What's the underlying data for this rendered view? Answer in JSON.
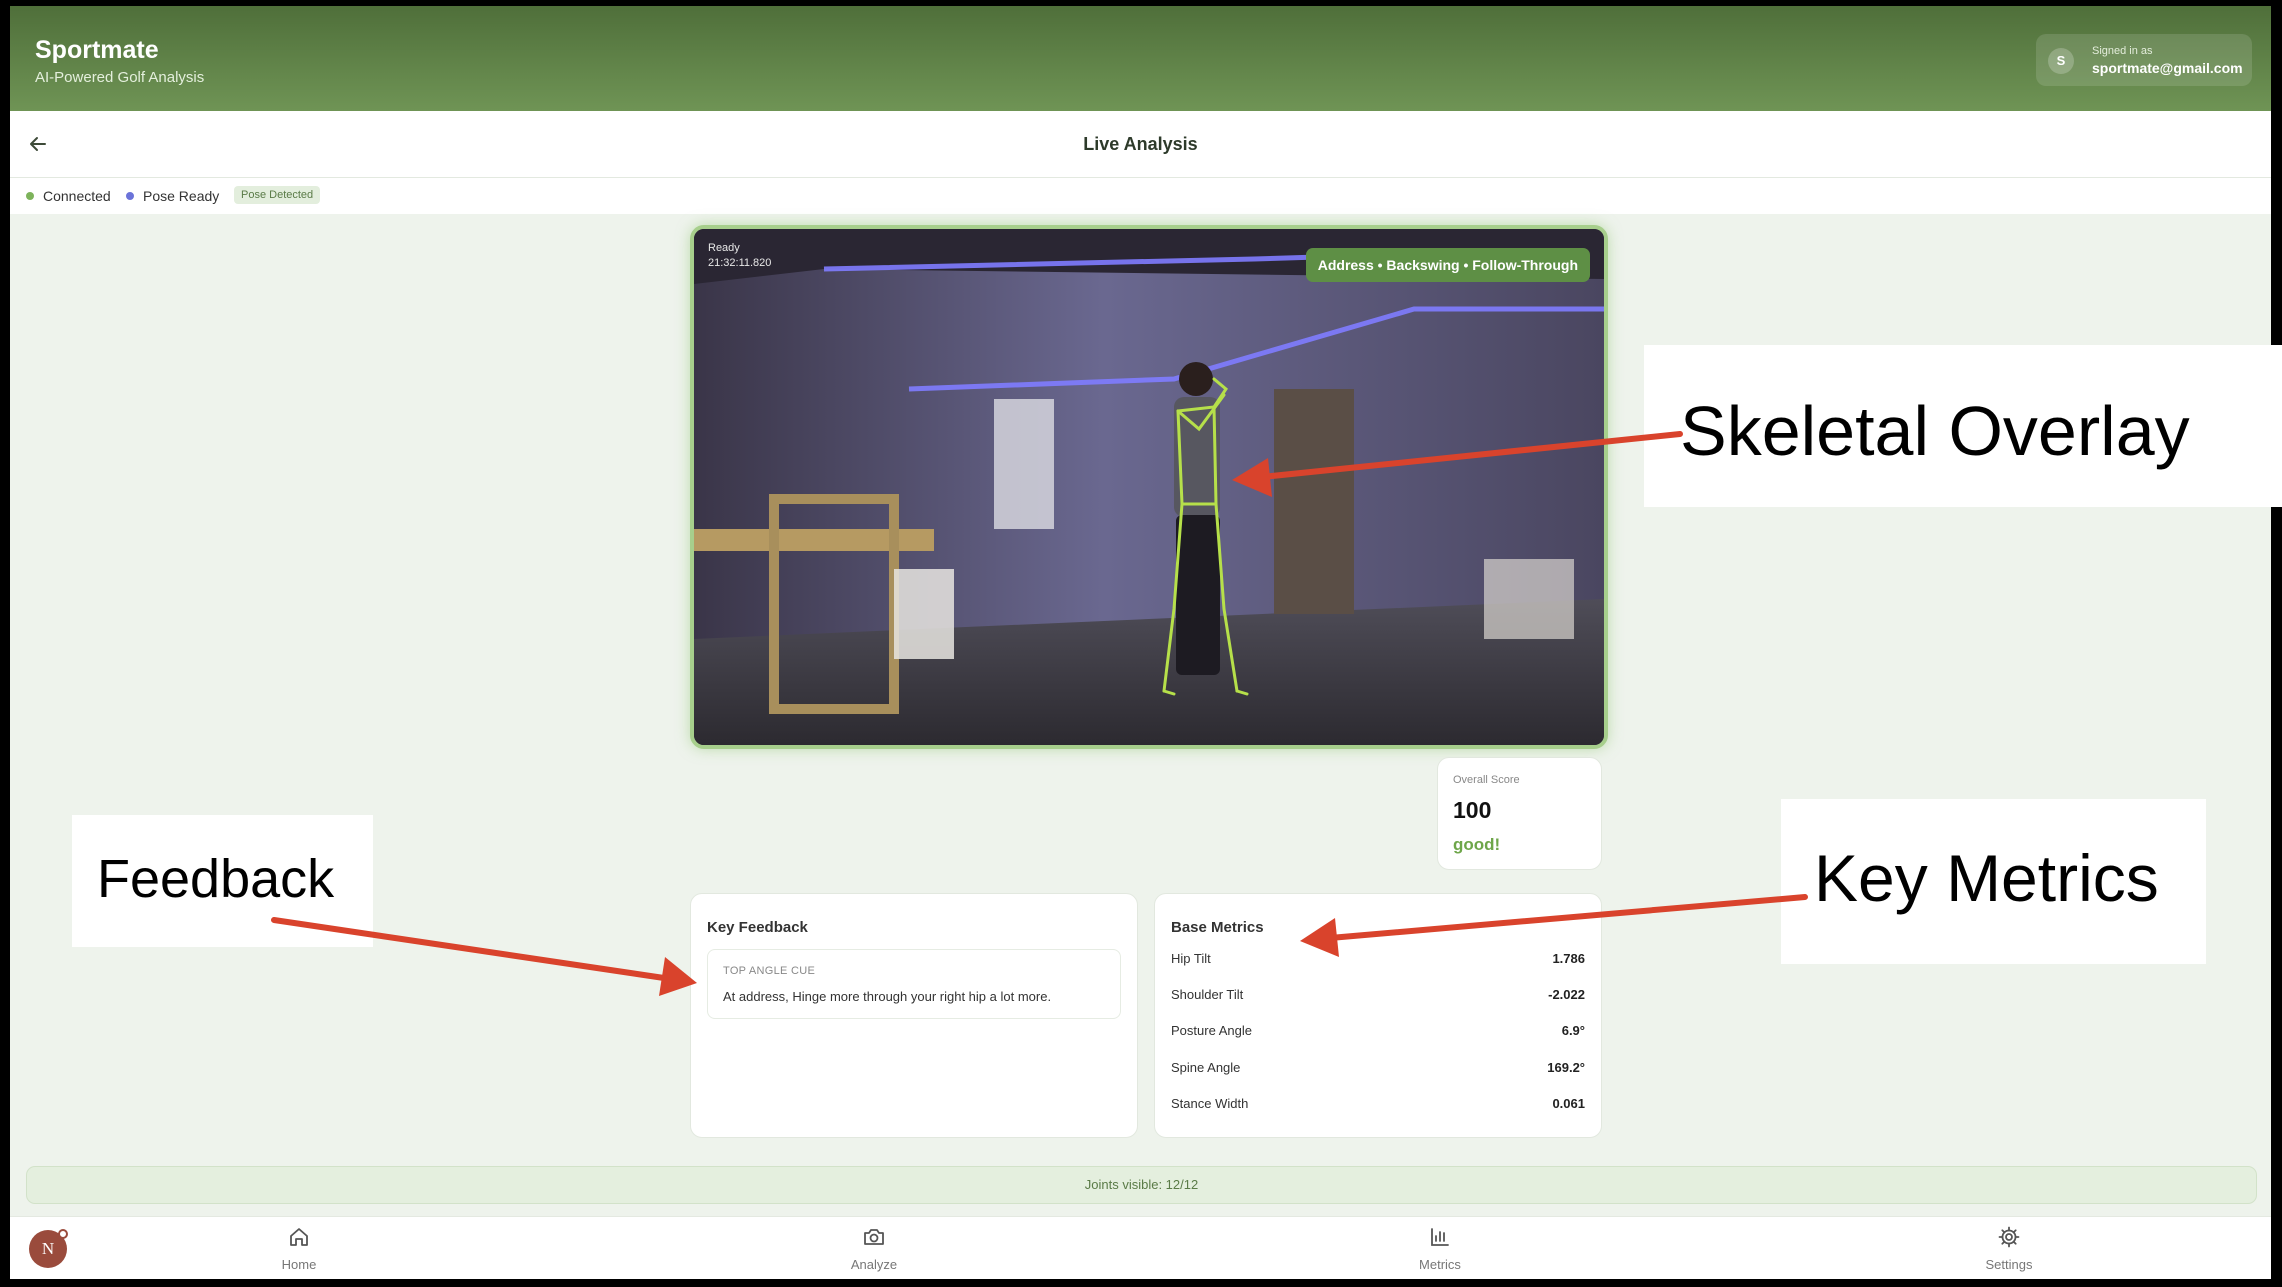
{
  "app": {
    "name": "Sportmate",
    "tagline": "AI-Powered Golf Analysis"
  },
  "account": {
    "initial": "S",
    "signed_in_label": "Signed in as",
    "email": "sportmate@gmail.com"
  },
  "page": {
    "title": "Live Analysis"
  },
  "status": {
    "connected": "Connected",
    "pose_ready": "Pose Ready",
    "pose_detected": "Pose Detected",
    "colors": {
      "connected": "#7db35b",
      "pose_ready": "#6b73d9"
    }
  },
  "video": {
    "state": "Ready",
    "timestamp": "21:32:11.820",
    "phases": "Address • Backswing • Follow-Through"
  },
  "score": {
    "label": "Overall Score",
    "value": "100",
    "verdict": "good!"
  },
  "feedback": {
    "title": "Key Feedback",
    "cue_label": "TOP ANGLE CUE",
    "cue_text": "At address, Hinge more through your right hip a lot more."
  },
  "metrics": {
    "title": "Base Metrics",
    "rows": [
      {
        "name": "Hip Tilt",
        "value": "1.786"
      },
      {
        "name": "Shoulder Tilt",
        "value": "-2.022"
      },
      {
        "name": "Posture Angle",
        "value": "6.9°"
      },
      {
        "name": "Spine Angle",
        "value": "169.2°"
      },
      {
        "name": "Stance Width",
        "value": "0.061"
      }
    ]
  },
  "joints": "Joints visible: 12/12",
  "nav": {
    "user_initial": "N",
    "items": [
      {
        "label": "Home",
        "icon": "home-icon"
      },
      {
        "label": "Analyze",
        "icon": "camera-icon"
      },
      {
        "label": "Metrics",
        "icon": "bar-chart-icon"
      },
      {
        "label": "Settings",
        "icon": "gear-icon"
      }
    ]
  },
  "annotations": {
    "skeletal_overlay": "Skeletal Overlay",
    "feedback": "Feedback",
    "key_metrics": "Key Metrics",
    "arrow_color": "#d9432c"
  },
  "colors": {
    "header": "#5f8448",
    "accent": "#6ea64a",
    "background": "#eef3ec"
  }
}
